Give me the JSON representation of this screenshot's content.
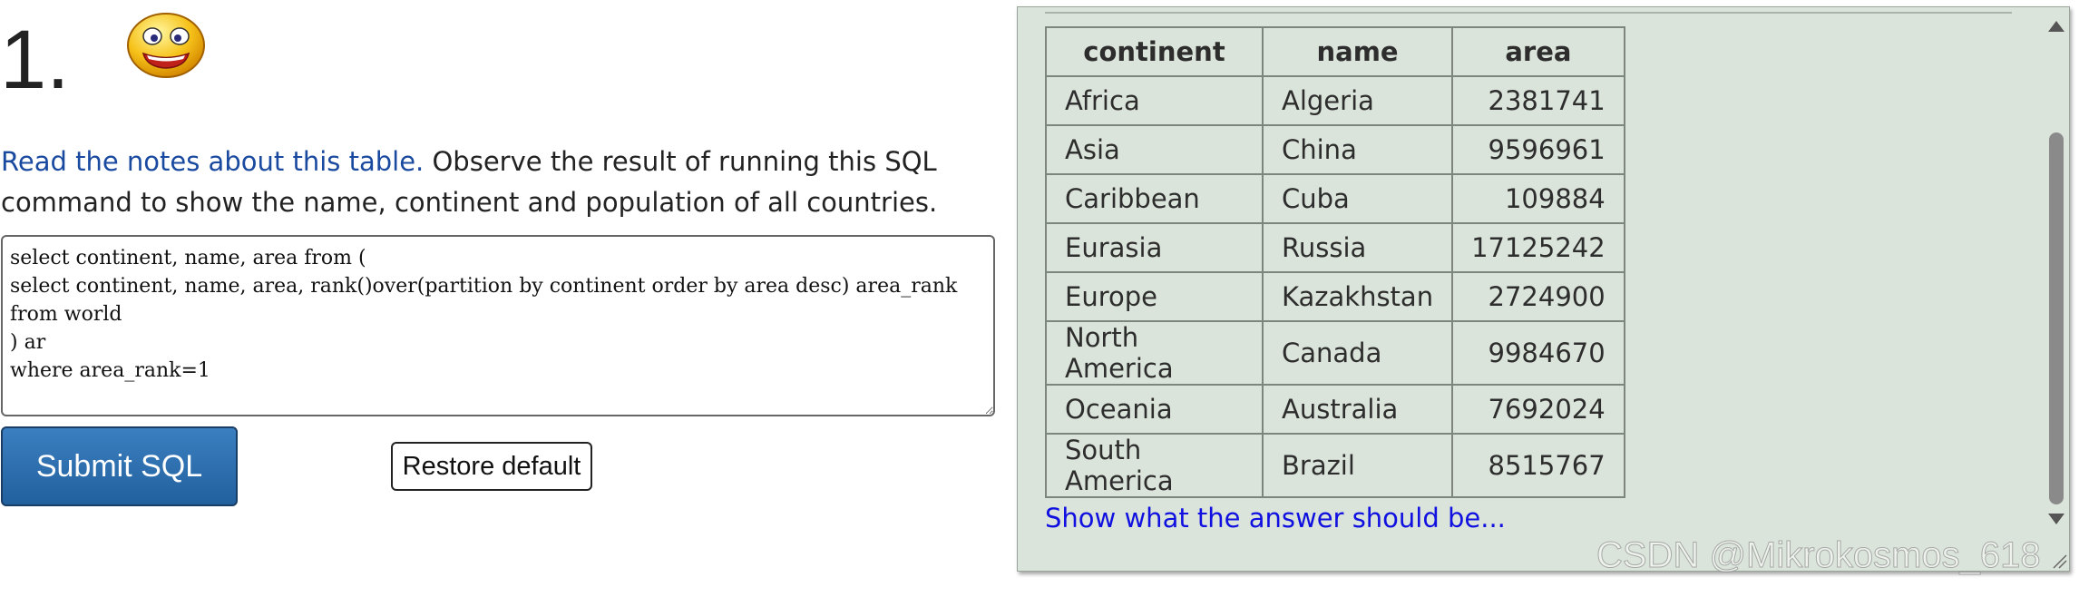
{
  "question": {
    "number": "1.",
    "icon": "smiley-face-icon",
    "notes_link": "Read the notes about this table.",
    "description": " Observe the result of running this SQL command to show the name, continent and population of all countries."
  },
  "editor": {
    "sql": "select continent, name, area from (\nselect continent, name, area, rank()over(partition by continent order by area desc) area_rank from world\n) ar\nwhere area_rank=1"
  },
  "buttons": {
    "submit_label": "Submit SQL",
    "restore_label": "Restore default"
  },
  "result": {
    "headers": [
      "continent",
      "name",
      "area"
    ],
    "rows": [
      [
        "Africa",
        "Algeria",
        "2381741"
      ],
      [
        "Asia",
        "China",
        "9596961"
      ],
      [
        "Caribbean",
        "Cuba",
        "109884"
      ],
      [
        "Eurasia",
        "Russia",
        "17125242"
      ],
      [
        "Europe",
        "Kazakhstan",
        "2724900"
      ],
      [
        "North America",
        "Canada",
        "9984670"
      ],
      [
        "Oceania",
        "Australia",
        "7692024"
      ],
      [
        "South America",
        "Brazil",
        "8515767"
      ]
    ],
    "answer_link": "Show what the answer should be..."
  },
  "watermark": "CSDN @Mikrokosmos_618",
  "colors": {
    "panel_background": "#dbe4da",
    "submit_button": "#2a6aad",
    "link": "#1a4aa0",
    "answer_link": "#1010e0"
  }
}
